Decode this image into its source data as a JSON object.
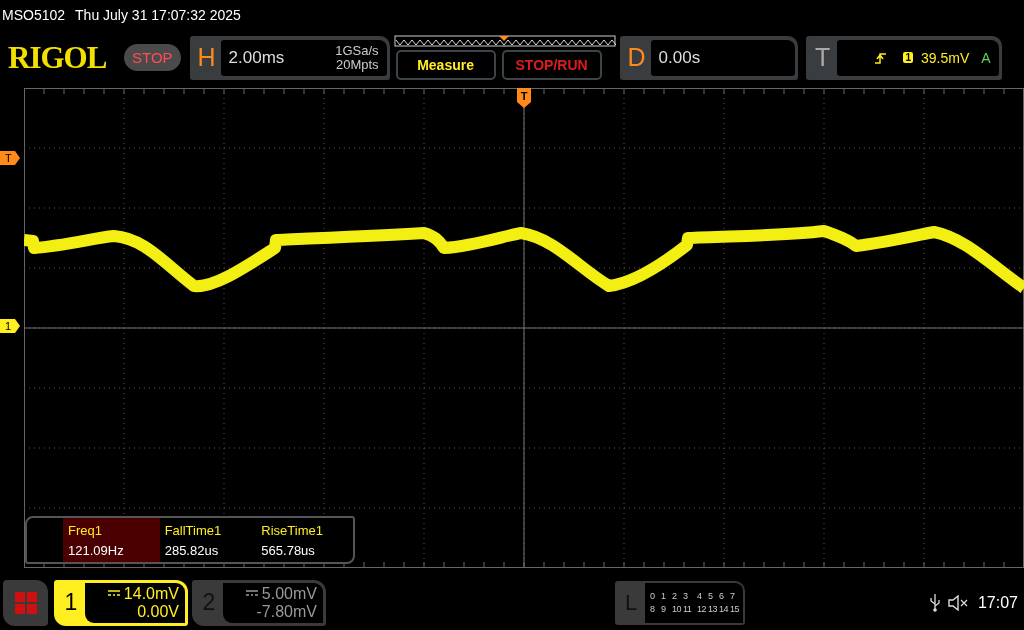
{
  "title_bar": {
    "model": "MSO5102",
    "datetime": "Thu July 31 17:07:32 2025"
  },
  "toolbar": {
    "logo": "RIGOL",
    "run_state": "STOP",
    "horizontal": {
      "label": "H",
      "timebase": "2.00ms",
      "sample_rate": "1GSa/s",
      "memory_depth": "20Mpts"
    },
    "buttons": [
      {
        "label": "Measure",
        "kind": "measure"
      },
      {
        "label": "STOP/RUN",
        "kind": "stoprun"
      }
    ],
    "delay": {
      "label": "D",
      "value": "0.00s"
    },
    "trigger": {
      "label": "T",
      "source": "1",
      "level": "39.5mV",
      "mode": "A"
    }
  },
  "screen": {
    "trigger_position_marker": "T",
    "trigger_level_marker": "T",
    "channel_marker": "1",
    "measurements": [
      {
        "name": "Freq1",
        "value": "121.09Hz",
        "selected": true
      },
      {
        "name": "FallTime1",
        "value": "285.82us",
        "selected": false
      },
      {
        "name": "RiseTime1",
        "value": "565.78us",
        "selected": false
      }
    ]
  },
  "channels": [
    {
      "number": "1",
      "scale": "14.0mV",
      "offset": "0.00V",
      "on": true
    },
    {
      "number": "2",
      "scale": "5.00mV",
      "offset": "-7.80mV",
      "on": false
    }
  ],
  "logic": {
    "label": "L",
    "rows": [
      [
        "0",
        "1",
        "2",
        "3",
        "4",
        "5",
        "6",
        "7"
      ],
      [
        "8",
        "9",
        "10",
        "11",
        "12",
        "13",
        "14",
        "15"
      ]
    ]
  },
  "status": {
    "time": "17:07"
  }
}
